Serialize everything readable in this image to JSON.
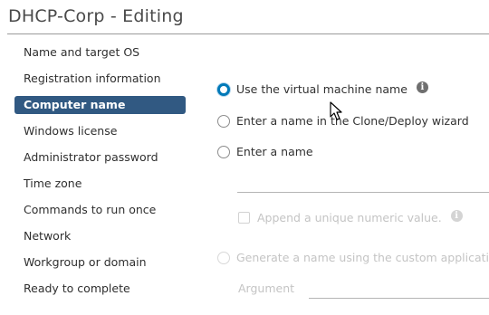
{
  "window": {
    "title": "DHCP-Corp - Editing"
  },
  "sidebar": {
    "items": [
      {
        "label": "Name and target OS",
        "active": false
      },
      {
        "label": "Registration information",
        "active": false
      },
      {
        "label": "Computer name",
        "active": true
      },
      {
        "label": "Windows license",
        "active": false
      },
      {
        "label": "Administrator password",
        "active": false
      },
      {
        "label": "Time zone",
        "active": false
      },
      {
        "label": "Commands to run once",
        "active": false
      },
      {
        "label": "Network",
        "active": false
      },
      {
        "label": "Workgroup or domain",
        "active": false
      },
      {
        "label": "Ready to complete",
        "active": false
      }
    ]
  },
  "main": {
    "options": {
      "use_vm_name": "Use the virtual machine name",
      "enter_in_wizard": "Enter a name in the Clone/Deploy wizard",
      "enter_name": "Enter a name",
      "append_numeric": "Append a unique numeric value.",
      "generate_custom": "Generate a name using the custom application",
      "argument_label": "Argument"
    },
    "selected_option": "use_vm_name",
    "name_value": "",
    "argument_value": ""
  },
  "colors": {
    "accent": "#0079b8",
    "sidebar_active_bg": "#315982"
  },
  "icons": {
    "info": "info-circle-icon",
    "cursor": "mouse-pointer-icon"
  }
}
